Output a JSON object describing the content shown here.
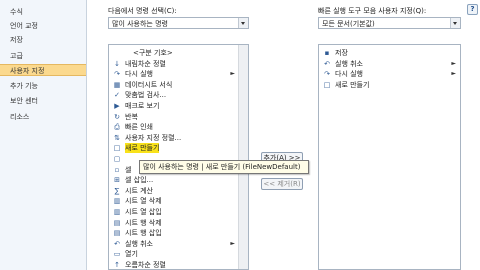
{
  "sidebar": {
    "items": [
      {
        "label": "수식"
      },
      {
        "label": "언어 교정"
      },
      {
        "label": "저장"
      },
      {
        "label": "고급"
      },
      {
        "label": "사용자 지정"
      },
      {
        "label": "추가 기능"
      },
      {
        "label": "보안 센터"
      },
      {
        "label": "리소스"
      }
    ],
    "active_index": 4
  },
  "left_panel": {
    "label": "다음에서 명령 선택(C):",
    "combo_value": "많이 사용하는 명령",
    "items": [
      {
        "label": "<구분 기호>",
        "icon": "separator"
      },
      {
        "label": "내림차순 정렬",
        "icon": "sort-descending-icon"
      },
      {
        "label": "다시 실행",
        "icon": "redo-icon",
        "arrow": "►"
      },
      {
        "label": "데이터시트 서식",
        "icon": "datasheet-icon"
      },
      {
        "label": "맞춤법 검사...",
        "icon": "spellcheck-icon"
      },
      {
        "label": "매크로 보기",
        "icon": "macro-icon"
      },
      {
        "label": "반복",
        "icon": "repeat-icon"
      },
      {
        "label": "빠른 인쇄",
        "icon": "quick-print-icon"
      },
      {
        "label": "사용자 지정 정렬...",
        "icon": "custom-sort-icon"
      },
      {
        "label": "새로 만들기",
        "icon": "new-document-icon",
        "highlight": true
      },
      {
        "label": "",
        "icon": "selection-icon"
      },
      {
        "label": "셀",
        "icon": "cell-icon"
      },
      {
        "label": "셀 삽입...",
        "icon": "insert-cell-icon"
      },
      {
        "label": "시트 계산",
        "icon": "calc-sheet-icon"
      },
      {
        "label": "시트 열 삭제",
        "icon": "delete-column-icon"
      },
      {
        "label": "시트 열 삽입",
        "icon": "insert-column-icon"
      },
      {
        "label": "시트 행 삭제",
        "icon": "delete-row-icon"
      },
      {
        "label": "시트 행 삽입",
        "icon": "insert-row-icon"
      },
      {
        "label": "실행 취소",
        "icon": "undo-icon",
        "arrow": "►"
      },
      {
        "label": "열기",
        "icon": "open-folder-icon"
      },
      {
        "label": "오름차순 정렬",
        "icon": "sort-ascending-icon"
      }
    ]
  },
  "right_panel": {
    "label": "빠른 실행 도구 모음 사용자 지정(Q):",
    "combo_value": "모든 문서(기본값)",
    "items": [
      {
        "label": "저장",
        "icon": "save-icon"
      },
      {
        "label": "실행 취소",
        "icon": "undo-icon",
        "arrow": "►"
      },
      {
        "label": "다시 실행",
        "icon": "redo-icon",
        "arrow": "►"
      },
      {
        "label": "새로 만들기",
        "icon": "new-document-icon"
      }
    ]
  },
  "buttons": {
    "add_label": "추가(A) >>",
    "remove_label": "<< 제거(R)"
  },
  "tooltip": {
    "text": "많이 사용하는 명령 | 새로 만들기 (FileNewDefault)"
  }
}
